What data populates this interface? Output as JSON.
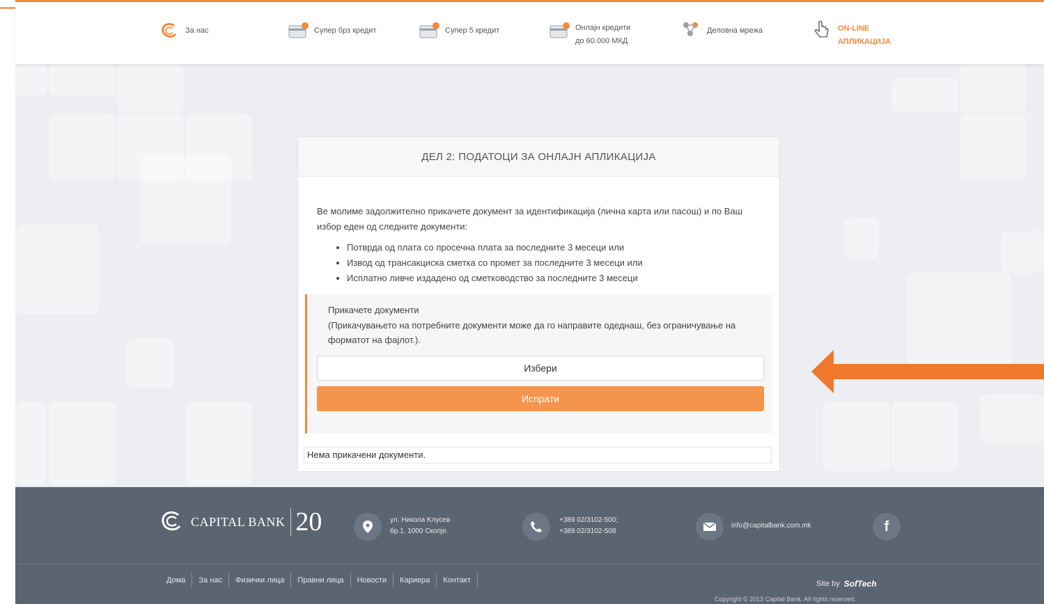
{
  "nav": {
    "items": [
      {
        "label": "За нас",
        "icon": "swirl-logo-icon"
      },
      {
        "label": "Супер брз кредит",
        "icon": "card-icon"
      },
      {
        "label": "Супер 5 кредит",
        "icon": "card-icon"
      },
      {
        "label": "Онлајн кредити до 60.000 МКД",
        "line1": "Онлајн кредити",
        "line2": "до 60.000 МКД",
        "icon": "card-icon"
      },
      {
        "label": "Деловна мрежа",
        "icon": "network-icon"
      },
      {
        "label": "ON-LINE АПЛИКАЦИЈА",
        "line1": "ON-LINE",
        "line2": "АПЛИКАЦИЈА",
        "icon": "hand-pointer-icon",
        "active": true
      }
    ]
  },
  "card": {
    "title": "ДЕЛ 2: ПОДАТОЦИ ЗА ОНЛАЈН АПЛИКАЦИЈА",
    "intro": "Ве молиме задолжително прикачете документ за идентификација (лична карта или пасош) и по Ваш избор еден од следните документи:",
    "documents": [
      "Потврда од плата со просечна плата за последните 3 месеци или",
      "Извод од трансакциска сметка со промет за последните 3 месеци или",
      "Исплатно ливче издадено од сметководство за последните 3 месеци"
    ],
    "upload_title": "Прикачете документи",
    "upload_note": "(Прикачувањето на потребните документи може да го направите одеднаш, без ограничување на форматот на фајлот.).",
    "choose_label": "Избери",
    "send_label": "Испрати",
    "no_documents": "Нема прикачени документи."
  },
  "footer": {
    "logo_text": "CAPITAL BANK",
    "logo_anniversary": "20",
    "address_line1": "ул. Никола Kлусев",
    "address_line2": "бр.1, 1000 Скопје.",
    "phone_line1": "+389 02/3102-500;",
    "phone_line2": "+389 02/3102-508",
    "email": "info@capitalbank.com.mk",
    "links": [
      "Дома",
      "За нас",
      "Физички лица",
      "Правни лица",
      "Новости",
      "Кариера",
      "Контакт"
    ],
    "site_by_label": "Site by",
    "site_by_name": "SofTech",
    "copyright": "Copyright © 2013 Capital Bank. All rights reserved."
  },
  "colors": {
    "accent": "#f08a3c",
    "button": "#f5944c",
    "footer": "#5b6471"
  }
}
